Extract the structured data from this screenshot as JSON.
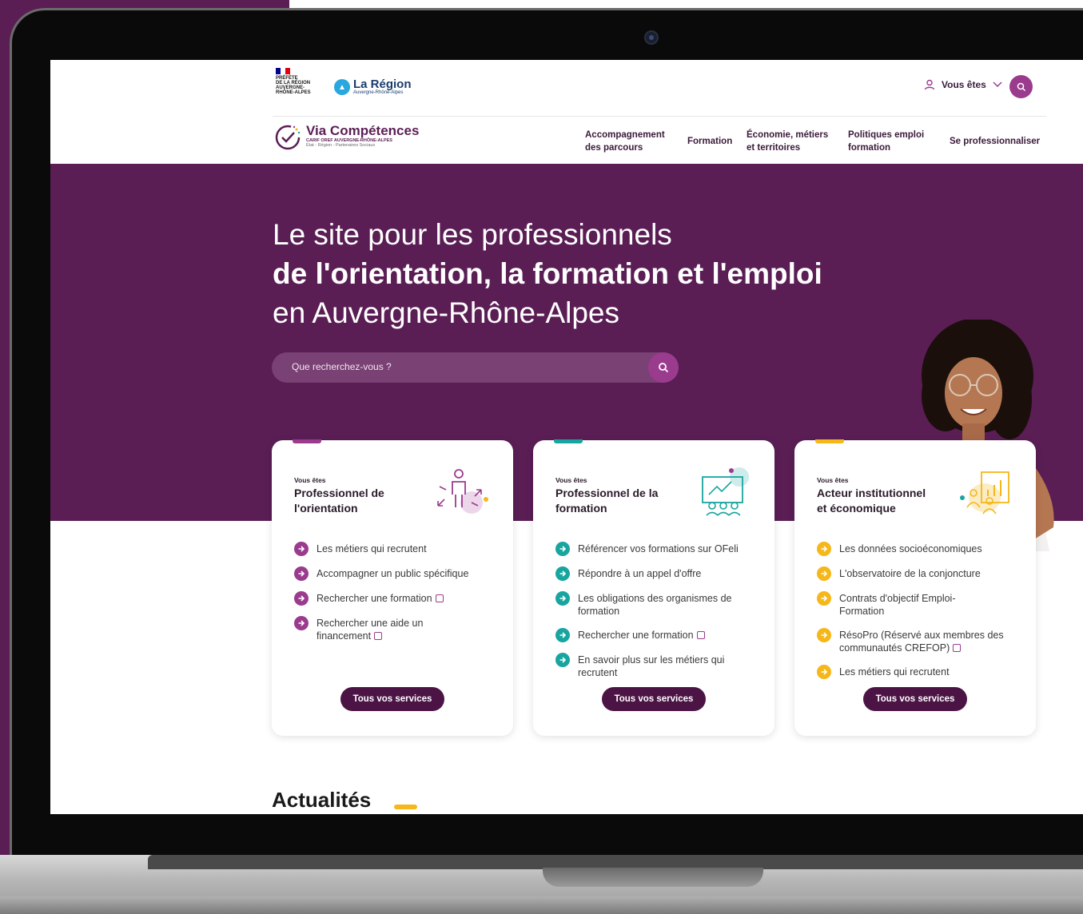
{
  "header": {
    "prefet_logo_text": "PRÉFÈTE\nDE LA RÉGION\nAUVERGNE-\nRHÔNE-ALPES",
    "region_logo": {
      "name": "La Région",
      "sub": "Auvergne-Rhône-Alpes"
    },
    "vous_etes_label": "Vous êtes",
    "brand": {
      "name": "Via Compétences",
      "sub1": "CARIF OREF AUVERGNE-RHÔNE-ALPES",
      "sub2": "État - Région - Partenaires Sociaux"
    },
    "nav": [
      {
        "label": "Accompagnement des parcours"
      },
      {
        "label": "Formation"
      },
      {
        "label": "Économie, métiers et territoires"
      },
      {
        "label": "Politiques emploi formation"
      },
      {
        "label": "Se professionnaliser"
      }
    ]
  },
  "hero": {
    "line1": "Le site pour les professionnels",
    "line2": "de l'orientation, la formation et l'emploi",
    "line3": "en Auvergne-Rhône-Alpes",
    "search_placeholder": "Que recherchez-vous ?"
  },
  "cards": [
    {
      "kicker": "Vous êtes",
      "title": "Professionnel de l'orientation",
      "accent": "#9b3b8e",
      "items": [
        {
          "label": "Les métiers qui recrutent",
          "external": false
        },
        {
          "label": "Accompagner un public spécifique",
          "external": false
        },
        {
          "label": "Rechercher une formation",
          "external": true
        },
        {
          "label": "Rechercher une aide un financement",
          "external": true
        }
      ],
      "button": "Tous vos services"
    },
    {
      "kicker": "Vous êtes",
      "title": "Professionnel de la formation",
      "accent": "#18a5a0",
      "items": [
        {
          "label": "Référencer vos formations sur OFeli",
          "external": false
        },
        {
          "label": "Répondre à un appel d'offre",
          "external": false
        },
        {
          "label": "Les obligations des organismes de formation",
          "external": false
        },
        {
          "label": "Rechercher une formation",
          "external": true
        },
        {
          "label": "En savoir plus sur les métiers qui recrutent",
          "external": false
        }
      ],
      "button": "Tous vos services"
    },
    {
      "kicker": "Vous êtes",
      "title": "Acteur institutionnel et économique",
      "accent": "#f5b71a",
      "items": [
        {
          "label": "Les données socioéconomiques",
          "external": false
        },
        {
          "label": "L'observatoire de la conjoncture",
          "external": false
        },
        {
          "label": "Contrats d'objectif Emploi-Formation",
          "external": false
        },
        {
          "label": "RésoPro (Réservé aux membres des communautés CREFOP)",
          "external": true
        },
        {
          "label": "Les métiers qui recrutent",
          "external": false
        }
      ],
      "button": "Tous vos services"
    }
  ],
  "news": {
    "title": "Actualités"
  },
  "colors": {
    "brand_purple": "#5a1e55",
    "accent_purple": "#9b3b8e",
    "teal": "#18a5a0",
    "yellow": "#f5b71a",
    "button_dark": "#4b1445"
  }
}
